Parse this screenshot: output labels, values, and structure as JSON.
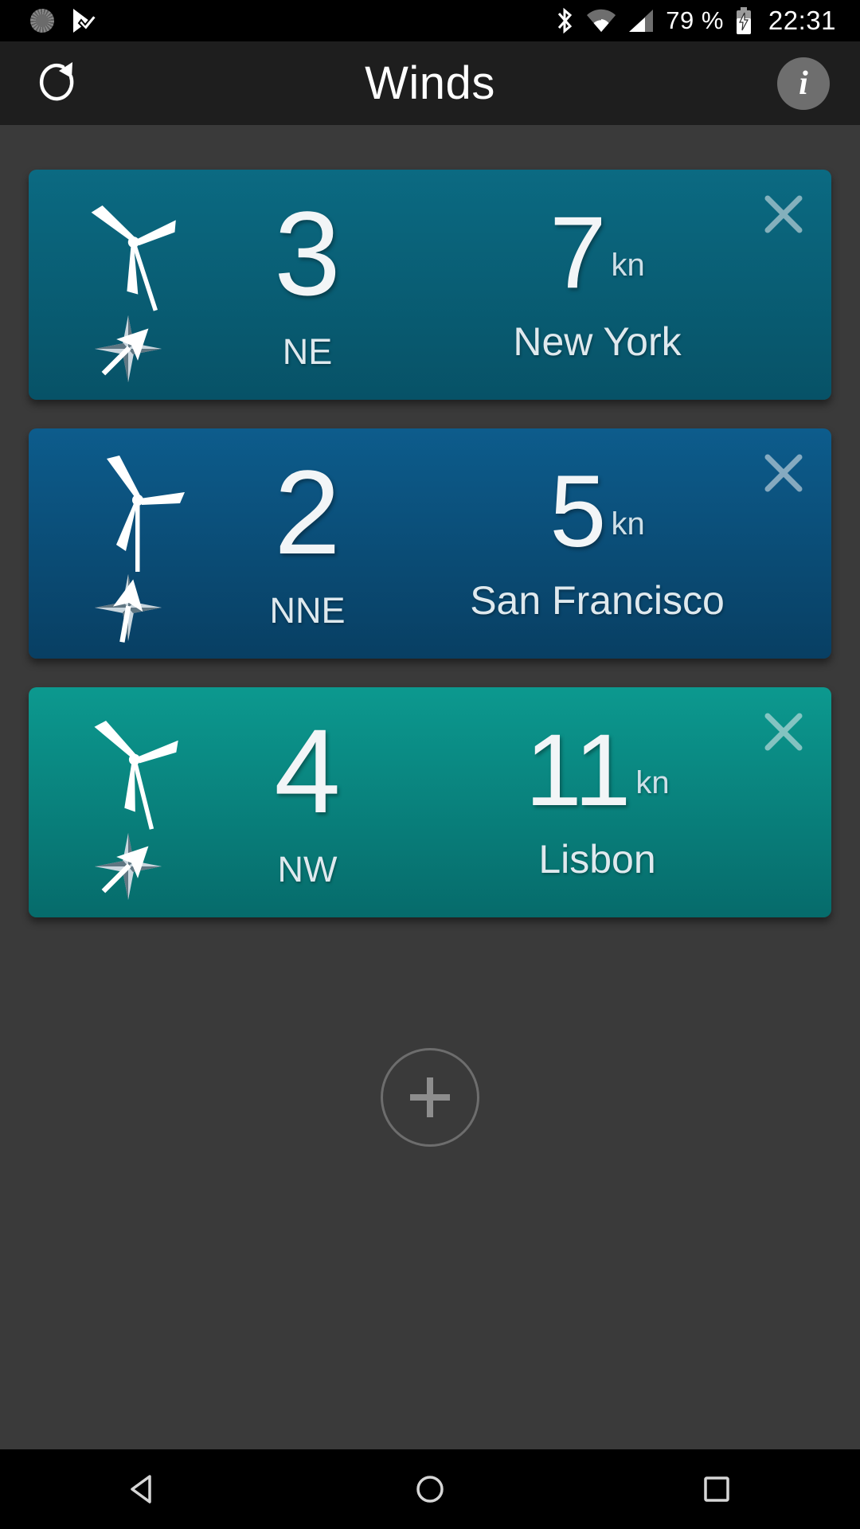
{
  "status_bar": {
    "notifications": [
      {
        "icon": "sync-spinner-icon"
      },
      {
        "icon": "play-check-icon"
      }
    ],
    "bluetooth_icon": "bluetooth-icon",
    "wifi_icon": "wifi-icon",
    "cellular_icon": "cellular-signal-icon",
    "battery_percent": "79 %",
    "battery_icon": "battery-charging-icon",
    "time": "22:31"
  },
  "app_bar": {
    "refresh_icon": "refresh-icon",
    "title": "Winds",
    "info_label": "i",
    "info_icon": "info-icon"
  },
  "cards": [
    {
      "beaufort": "3",
      "direction": "NE",
      "speed": "7",
      "unit": "kn",
      "city": "New York",
      "color_top": "#0b6a82",
      "color_bottom": "#075267",
      "turbine_rotation": -18,
      "arrow_rotation": 225,
      "close_label": "×"
    },
    {
      "beaufort": "2",
      "direction": "NNE",
      "speed": "5",
      "unit": "kn",
      "city": "San Francisco",
      "color_top": "#0d5c8c",
      "color_bottom": "#083f63",
      "turbine_rotation": 0,
      "arrow_rotation": 190,
      "close_label": "×"
    },
    {
      "beaufort": "4",
      "direction": "NW",
      "speed": "11",
      "unit": "kn",
      "city": "Lisbon",
      "color_top": "#0c998f",
      "color_bottom": "#066b6b",
      "turbine_rotation": -14,
      "arrow_rotation": 225,
      "close_label": "×"
    }
  ],
  "add_button": {
    "icon": "plus-icon",
    "label": "+"
  },
  "nav_bar": {
    "back_icon": "back-triangle-icon",
    "home_icon": "home-circle-icon",
    "recents_icon": "recents-square-icon"
  },
  "colors": {
    "background": "#3a3a3a",
    "app_bar": "#1e1e1e",
    "status_bar": "#000000",
    "nav_bar": "#000000",
    "text_primary": "#ffffff"
  }
}
